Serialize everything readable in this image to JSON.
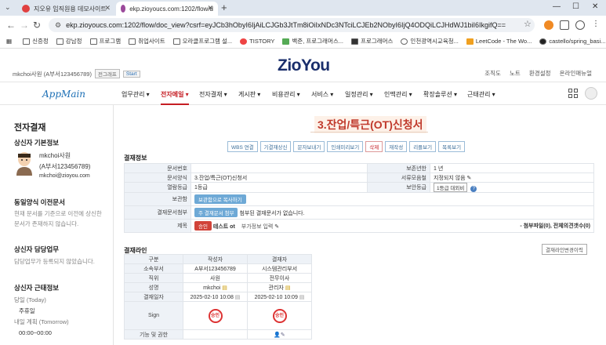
{
  "browser": {
    "tabs": [
      {
        "title": "지오유 임직원용 데모사이트",
        "active": false
      },
      {
        "title": "ekp.zioyoucs.com:1202/flow/d",
        "active": true
      }
    ],
    "url": "ekp.zioyoucs.com:1202/flow/doc_view?csrf=eyJCb3hObyI6IjAiLCJGb3JtTm8iOiIxNDc3NTciLCJEb2NObyI6IjQ4ODQiLCJHdWJ1biI6IkgifQ==",
    "bookmarks": [
      "신증정",
      "강남정",
      "프로그램",
      "취업사이트",
      "오라클프로그램 설...",
      "TISTORY",
      "백준, 프로그래머스...",
      "프로그래머스",
      "인천광역시교육청...",
      "LeetCode - The Wo...",
      "castello/spring_basi..."
    ]
  },
  "header": {
    "logo_a": "Zio",
    "logo_b": "You",
    "user": "mkchoi사원 (A부서123456789)",
    "user_btn1": "전그래프",
    "user_btn2": "Start",
    "links": [
      "조직도",
      "노트",
      "환경설정",
      "온라인매뉴얼"
    ]
  },
  "nav": {
    "app_title": "AppMain",
    "items": [
      "업무관리 ▾",
      "전자메일 ▾",
      "전자결재 ▾",
      "게시판 ▾",
      "비용관리 ▾",
      "서비스 ▾",
      "일정관리 ▾",
      "인맥관리 ▾",
      "확장솔루션 ▾",
      "근태관리 ▾"
    ]
  },
  "sidebar": {
    "title": "전자결재",
    "drafter_heading": "상신자 기본정보",
    "drafter_name": "mkchoi사원",
    "drafter_dept": "(A부서123456789)",
    "drafter_email": "mkchoi@zioyou.com",
    "same_form_heading": "동일양식 이전문서",
    "same_form_text1": "현재 문서를 기준으로 이전에 상신한",
    "same_form_text2": "문서가 존재하지 않습니다.",
    "duty_heading": "상신자 담당업무",
    "duty_text": "담당업무가 등록되지 않았습니다.",
    "attend_heading": "상신자 근태정보",
    "today_label": "당일 (Today)",
    "today_value": "주휴일",
    "tomorrow_label": "내일 계획 (Tomorrow)",
    "tomorrow_value": "00:00~00:00"
  },
  "doc": {
    "title": "3.잔업/특근(OT)신청서",
    "buttons": [
      "WBS 연결",
      "기결재상신",
      "문자보내기",
      "인쇄미리보기",
      "삭제",
      "재작성",
      "리플보기",
      "목록보기"
    ],
    "section_info": "결재정보",
    "labels": {
      "doc_no": "문서번호",
      "retention": "보존년한",
      "form": "문서양식",
      "visibility": "서류모음철",
      "access": "열람등급",
      "security": "보안등급",
      "archive": "보관함",
      "attach_doc": "결재문서첨부",
      "subject": "제목"
    },
    "values": {
      "doc_no": "",
      "retention": "1 년",
      "form": "3.잔업/특근(OT)신청서",
      "visibility": "지정되지 않음",
      "access": "1등급",
      "security": "1등급 대외비",
      "archive_btn": "보관함으로 복사하기",
      "attach_btn": "주 결재문서 첨부",
      "attach_text": "첨부된 결재문서가 없습니다.",
      "subject_badge": "승인",
      "subject_text": "테스트 ot",
      "subject_extra": "부가정보 입력",
      "attach_count_label": "- 첨부파일(0), 전체의견갯수(0)"
    },
    "section_line": "결재라인",
    "line_btn": "결재라인변경이력",
    "line_headers": [
      "구분",
      "작성자",
      "결재자"
    ],
    "line_rows": [
      {
        "label": "소속부서",
        "writer": "A부서123456789",
        "approver": "시스템관리부서"
      },
      {
        "label": "직위",
        "writer": "사원",
        "approver": "전무이사"
      },
      {
        "label": "성명",
        "writer": "mkchoi",
        "approver": "관리자"
      },
      {
        "label": "결재일자",
        "writer": "2025-02-10 10:08",
        "approver": "2025-02-10 10:09"
      },
      {
        "label": "Sign",
        "writer": "승인",
        "approver": "승인"
      },
      {
        "label": "기능 및 권한",
        "writer": "",
        "approver": ""
      }
    ]
  }
}
